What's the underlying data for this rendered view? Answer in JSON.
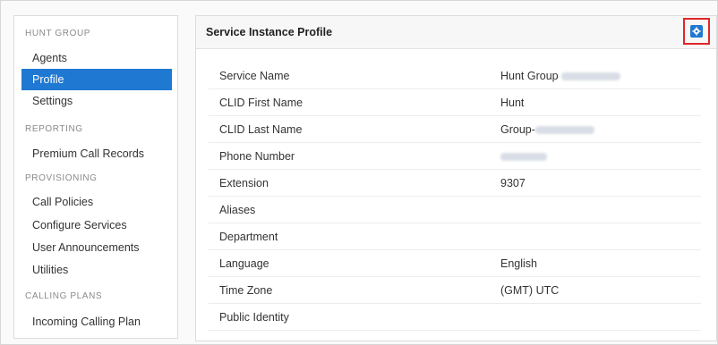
{
  "sidebar": {
    "sections": [
      {
        "heading": "HUNT GROUP",
        "items": [
          "Agents",
          "Profile",
          "Settings"
        ]
      },
      {
        "heading": "REPORTING",
        "items": [
          "Premium Call Records"
        ]
      },
      {
        "heading": "PROVISIONING",
        "items": [
          "Call Policies",
          "Configure Services",
          "User Announcements",
          "Utilities"
        ]
      },
      {
        "heading": "CALLING PLANS",
        "items": [
          "Incoming Calling Plan"
        ]
      }
    ],
    "active_item": "Profile"
  },
  "panel": {
    "title": "Service Instance Profile",
    "settings_icon": "gear-icon",
    "rows": [
      {
        "label": "Service Name",
        "value": "Hunt Group"
      },
      {
        "label": "CLID First Name",
        "value": "Hunt"
      },
      {
        "label": "CLID Last Name",
        "value": "Group-"
      },
      {
        "label": "Phone Number",
        "value": ""
      },
      {
        "label": "Extension",
        "value": "9307"
      },
      {
        "label": "Aliases",
        "value": ""
      },
      {
        "label": "Department",
        "value": ""
      },
      {
        "label": "Language",
        "value": "English"
      },
      {
        "label": "Time Zone",
        "value": "(GMT) UTC"
      },
      {
        "label": "Public Identity",
        "value": ""
      }
    ]
  },
  "colors": {
    "accent": "#1f78d1",
    "highlight": "#e0262b"
  }
}
